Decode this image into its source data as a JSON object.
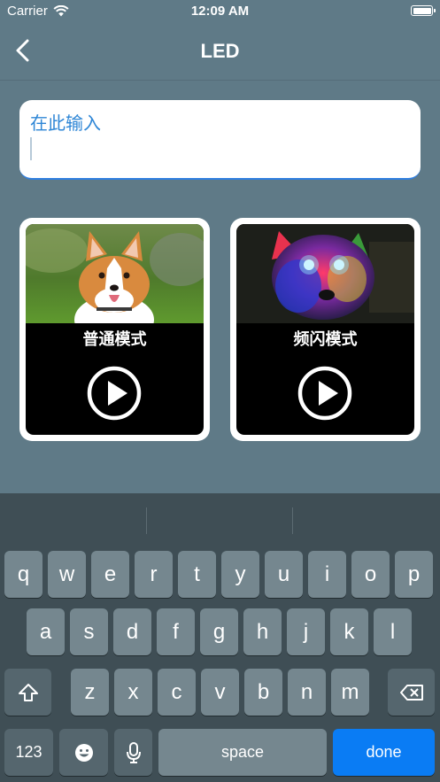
{
  "status_bar": {
    "carrier": "Carrier",
    "time": "12:09 AM",
    "battery_level": 1.0
  },
  "nav": {
    "title": "LED",
    "back_icon": "chevron-left-icon"
  },
  "input": {
    "placeholder": "在此输入",
    "value": ""
  },
  "modes": [
    {
      "label": "普通模式",
      "image": "corgi-dog-photo",
      "icon": "play-icon"
    },
    {
      "label": "频闪模式",
      "image": "husky-glowing-eyes-photo",
      "icon": "play-icon"
    }
  ],
  "keyboard": {
    "row1": [
      "q",
      "w",
      "e",
      "r",
      "t",
      "y",
      "u",
      "i",
      "o",
      "p"
    ],
    "row2": [
      "a",
      "s",
      "d",
      "f",
      "g",
      "h",
      "j",
      "k",
      "l"
    ],
    "row3": [
      "z",
      "x",
      "c",
      "v",
      "b",
      "n",
      "m"
    ],
    "numbers_label": "123",
    "space_label": "space",
    "done_label": "done"
  },
  "colors": {
    "background": "#5f7a87",
    "accent": "#0a7cf4",
    "input_text": "#2e86d6",
    "keyboard": "#3f4e55"
  }
}
